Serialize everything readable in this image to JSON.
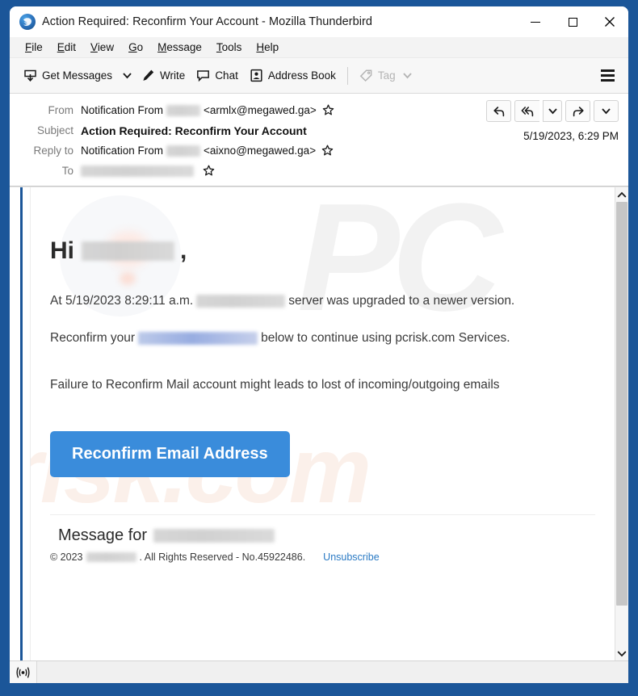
{
  "window": {
    "title": "Action Required: Reconfirm Your Account - Mozilla Thunderbird",
    "app_icon": "thunderbird-icon",
    "minimize_label": "Minimize",
    "maximize_label": "Maximize",
    "close_label": "Close"
  },
  "menubar": {
    "items": [
      {
        "pre": "",
        "key": "F",
        "post": "ile"
      },
      {
        "pre": "",
        "key": "E",
        "post": "dit"
      },
      {
        "pre": "",
        "key": "V",
        "post": "iew"
      },
      {
        "pre": "",
        "key": "G",
        "post": "o"
      },
      {
        "pre": "",
        "key": "M",
        "post": "essage"
      },
      {
        "pre": "",
        "key": "T",
        "post": "ools"
      },
      {
        "pre": "",
        "key": "H",
        "post": "elp"
      }
    ]
  },
  "toolbar": {
    "get_messages": "Get Messages",
    "write": "Write",
    "chat": "Chat",
    "address_book": "Address Book",
    "tag": "Tag",
    "menu_label": "Application menu"
  },
  "message_header": {
    "from_label": "From",
    "from_name": "Notification From",
    "from_address": "<armlx@megawed.ga>",
    "subject_label": "Subject",
    "subject": "Action Required: Reconfirm Your Account",
    "reply_to_label": "Reply to",
    "reply_to_name": "Notification From",
    "reply_to_address": "<aixno@megawed.ga>",
    "to_label": "To",
    "date": "5/19/2023, 6:29 PM",
    "actions": {
      "reply": "Reply",
      "reply_all": "Reply All",
      "reply_all_more": "More reply options",
      "forward": "Forward",
      "forward_more": "More forward options"
    }
  },
  "mail_body": {
    "greeting_prefix": "Hi",
    "greeting_suffix": ",",
    "paragraph1_a": "At 5/19/2023 8:29:11 a.m.",
    "paragraph1_b": "server was upgraded to a newer version.",
    "paragraph2_a": "Reconfirm your",
    "paragraph2_b": "below to continue using pcrisk.com Services.",
    "warning": "Failure to Reconfirm Mail account might leads to lost of incoming/outgoing emails",
    "cta_button": "Reconfirm Email Address",
    "message_for": "Message for",
    "copyright_a": "© 2023",
    "copyright_b": ". All Rights Reserved - No.45922486.",
    "unsubscribe": "Unsubscribe",
    "watermark_pc": "PC",
    "watermark_risk": "risk.com",
    "cta_color": "#3a8cdb",
    "link_color": "#2a7ac4"
  },
  "statusbar": {
    "connection_icon": "online-indicator-icon"
  }
}
